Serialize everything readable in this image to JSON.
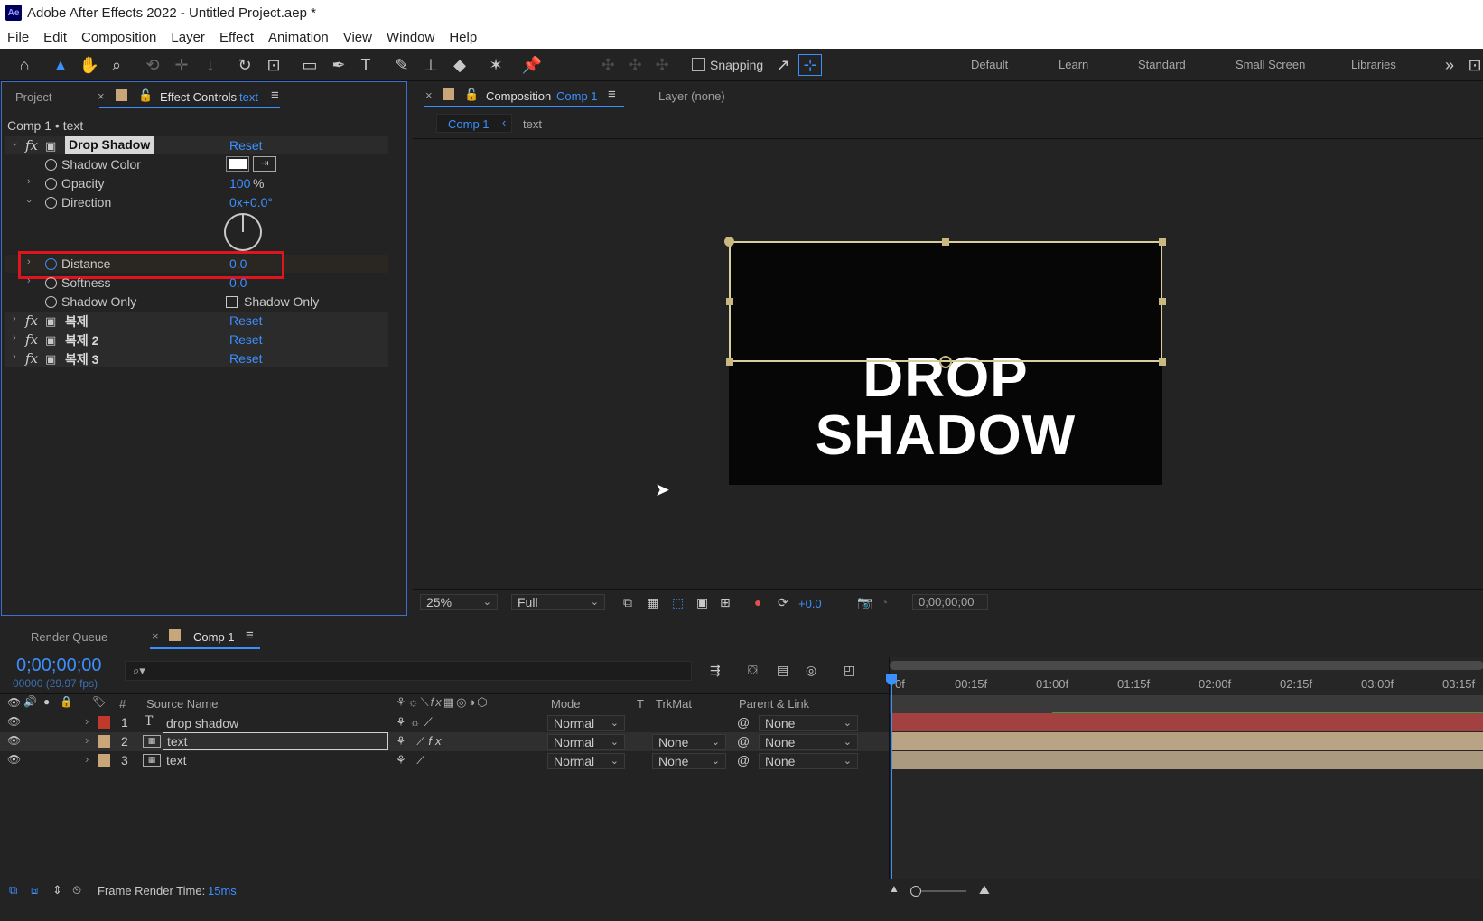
{
  "app": {
    "title": "Adobe After Effects 2022 - Untitled Project.aep *",
    "logo": "Ae"
  },
  "menu": [
    "File",
    "Edit",
    "Composition",
    "Layer",
    "Effect",
    "Animation",
    "View",
    "Window",
    "Help"
  ],
  "toolbar": {
    "snapping_label": "Snapping",
    "workspaces": [
      "Default",
      "Learn",
      "Standard",
      "Small Screen",
      "Libraries"
    ]
  },
  "effect_controls": {
    "tab_project": "Project",
    "tab_label": "Effect Controls",
    "tab_layer": "text",
    "breadcrumb": "Comp 1 • text",
    "effect_name": "Drop Shadow",
    "reset": "Reset",
    "shadow_color_label": "Shadow Color",
    "shadow_color": "#ffffff",
    "opacity_label": "Opacity",
    "opacity_value": "100",
    "opacity_unit": "%",
    "direction_label": "Direction",
    "direction_value": "0x+0.0°",
    "distance_label": "Distance",
    "distance_value": "0.0",
    "softness_label": "Softness",
    "softness_value": "0.0",
    "shadow_only_label": "Shadow Only",
    "shadow_only_checkbox_label": "Shadow Only",
    "other_effects": [
      {
        "name": "복제",
        "reset": "Reset"
      },
      {
        "name": "복제 2",
        "reset": "Reset"
      },
      {
        "name": "복제 3",
        "reset": "Reset"
      }
    ]
  },
  "composition": {
    "tab_label": "Composition",
    "tab_comp": "Comp 1",
    "layer_tab": "Layer (none)",
    "nav_comp": "Comp 1",
    "nav_layer": "text",
    "canvas_text": "DROP SHADOW",
    "zoom": "25%",
    "resolution": "Full",
    "exposure": "+0.0",
    "timecode": "0;00;00;00"
  },
  "timeline": {
    "render_queue_tab": "Render Queue",
    "comp_tab": "Comp 1",
    "timecode": "0;00;00;00",
    "frame_info": "00000 (29.97 fps)",
    "search_placeholder": "",
    "columns": {
      "hash": "#",
      "source_name": "Source Name",
      "mode": "Mode",
      "t": "T",
      "trkmat": "TrkMat",
      "parent": "Parent & Link"
    },
    "ruler": [
      "0f",
      "00:15f",
      "01:00f",
      "01:15f",
      "02:00f",
      "02:15f",
      "03:00f",
      "03:15f"
    ],
    "layers": [
      {
        "num": "1",
        "type_icon": "T",
        "name": "drop shadow",
        "color": "#c0392b",
        "mode": "Normal",
        "trkmat": "",
        "parent": "None",
        "bar_color": "#a34040"
      },
      {
        "num": "2",
        "type_icon": "comp",
        "name": "text",
        "color": "#c9a57a",
        "mode": "Normal",
        "trkmat": "None",
        "parent": "None",
        "bar_color": "#b8a484"
      },
      {
        "num": "3",
        "type_icon": "comp",
        "name": "text",
        "color": "#c9a57a",
        "mode": "Normal",
        "trkmat": "None",
        "parent": "None",
        "bar_color": "#a99a80"
      }
    ]
  },
  "status": {
    "label": "Frame Render Time:",
    "value": "15ms"
  }
}
